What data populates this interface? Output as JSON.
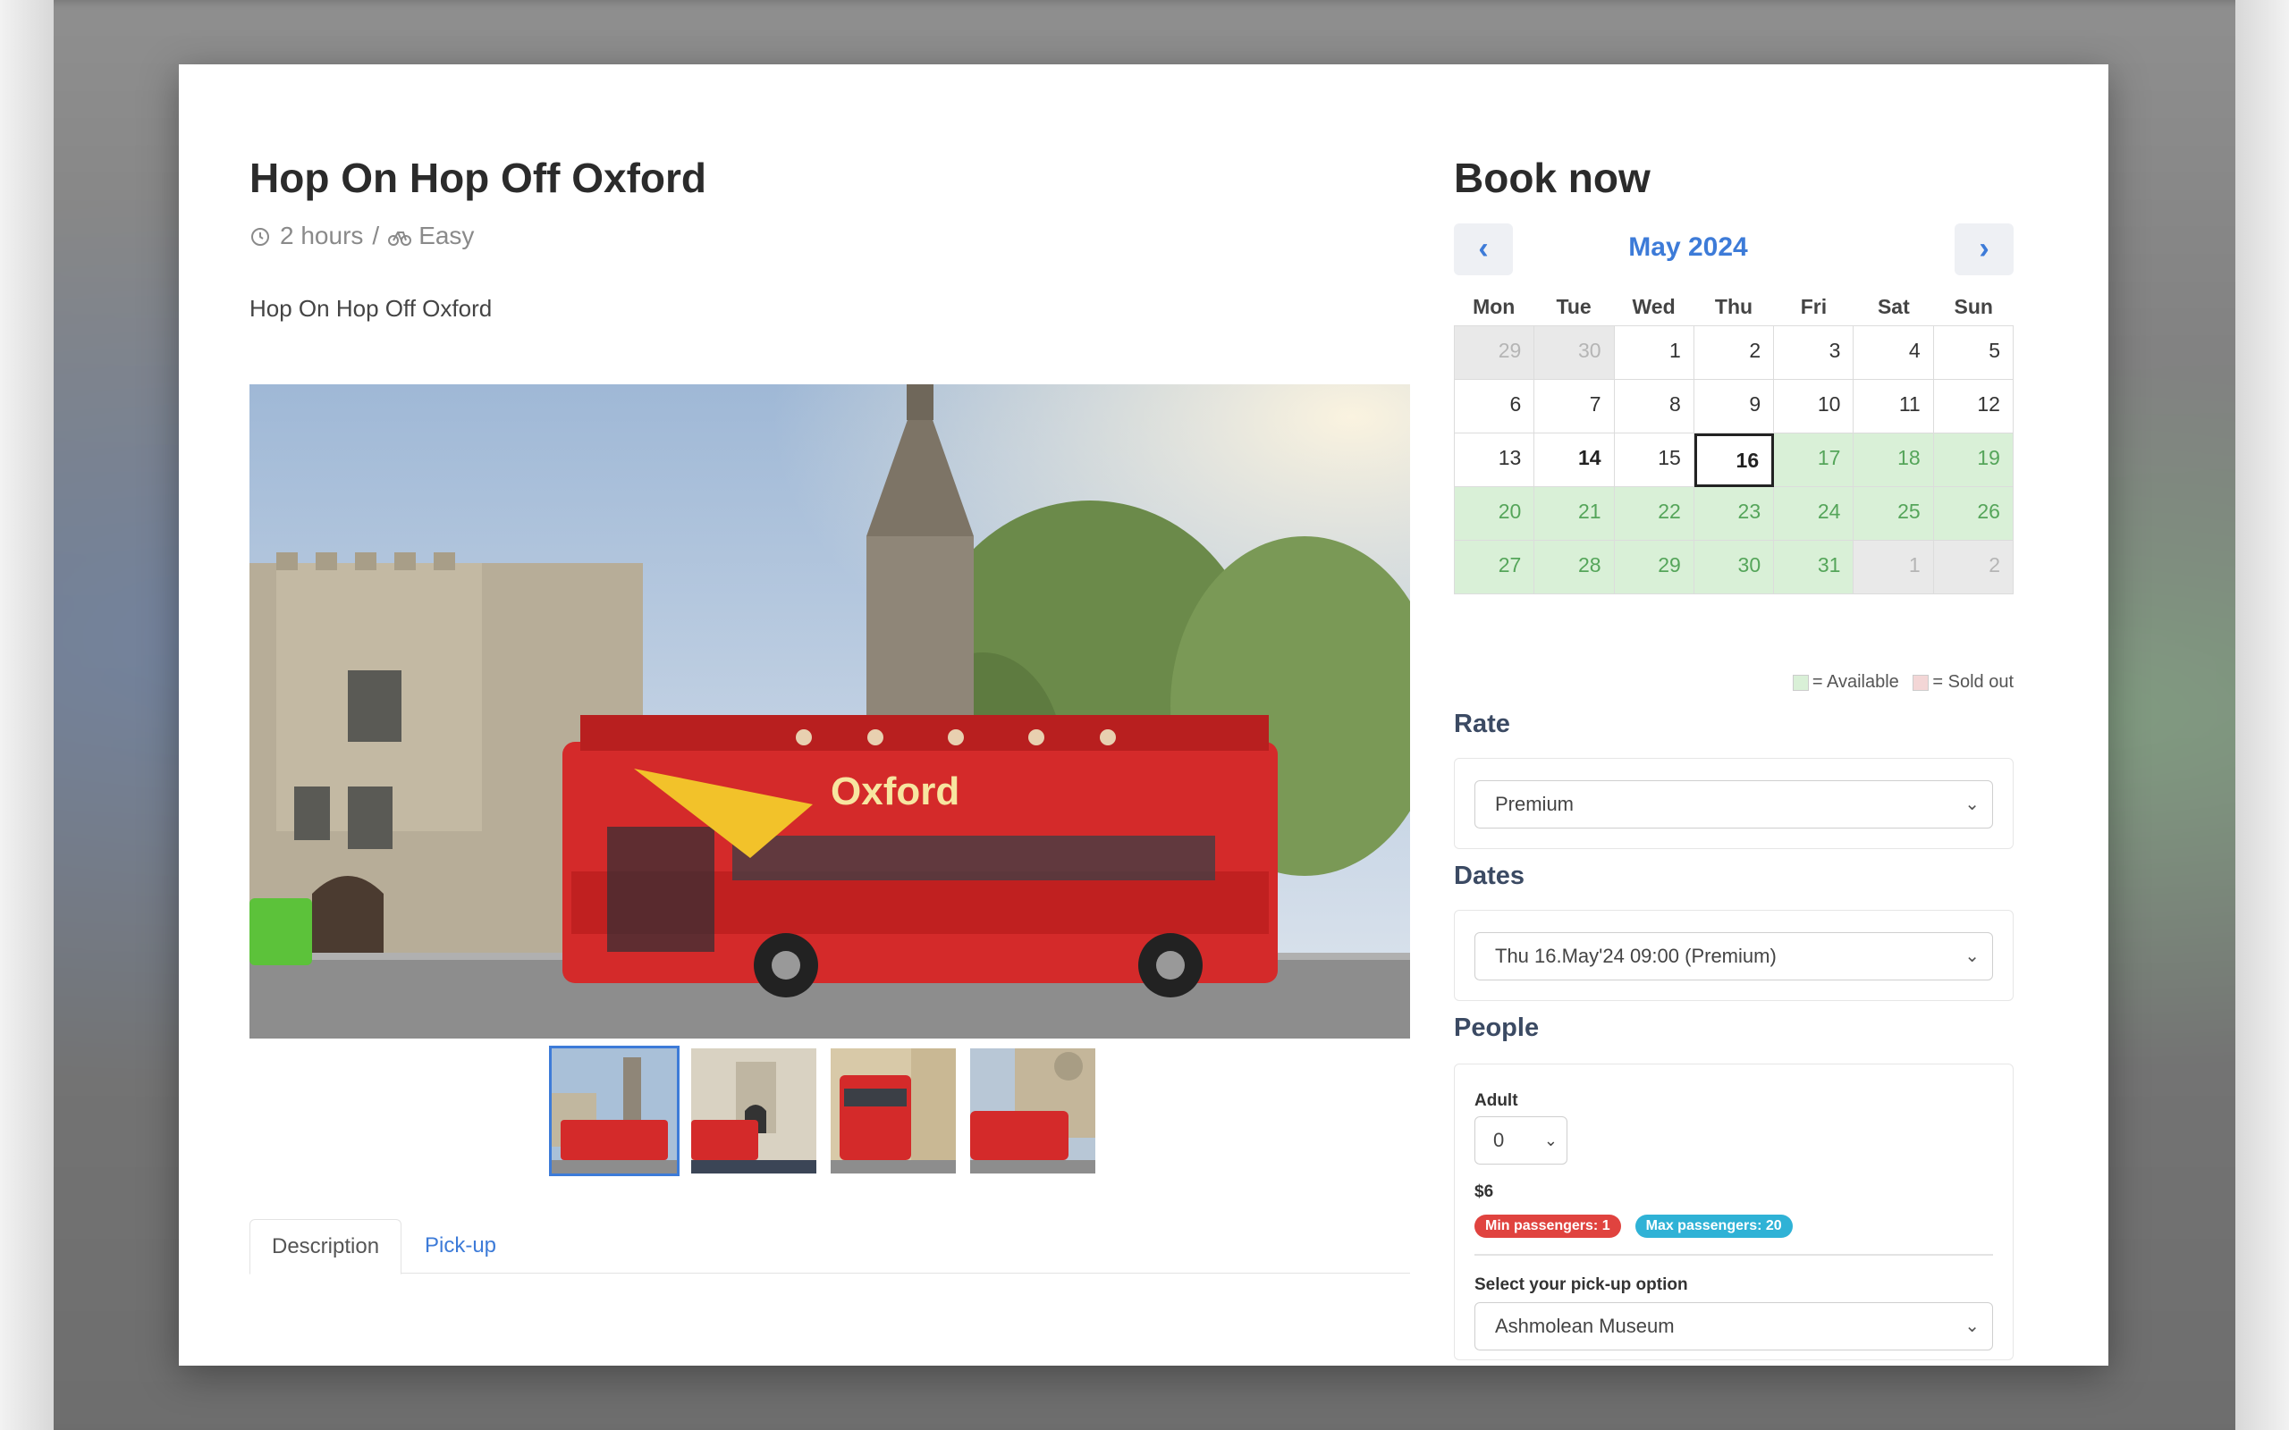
{
  "tour": {
    "title": "Hop On Hop Off Oxford",
    "duration": "2 hours",
    "separator": "/",
    "difficulty": "Easy",
    "short_description": "Hop On Hop Off Oxford"
  },
  "tabs": [
    {
      "label": "Description",
      "active": true
    },
    {
      "label": "Pick-up",
      "active": false
    }
  ],
  "booking": {
    "title": "Book now",
    "month": "May 2024",
    "prev_icon": "‹",
    "next_icon": "›",
    "weekdays": [
      "Mon",
      "Tue",
      "Wed",
      "Thu",
      "Fri",
      "Sat",
      "Sun"
    ],
    "days": [
      {
        "label": "29",
        "state": "muted"
      },
      {
        "label": "30",
        "state": "muted"
      },
      {
        "label": "1",
        "state": "normal"
      },
      {
        "label": "2",
        "state": "normal"
      },
      {
        "label": "3",
        "state": "normal"
      },
      {
        "label": "4",
        "state": "normal"
      },
      {
        "label": "5",
        "state": "normal"
      },
      {
        "label": "6",
        "state": "normal"
      },
      {
        "label": "7",
        "state": "normal"
      },
      {
        "label": "8",
        "state": "normal"
      },
      {
        "label": "9",
        "state": "normal"
      },
      {
        "label": "10",
        "state": "normal"
      },
      {
        "label": "11",
        "state": "normal"
      },
      {
        "label": "12",
        "state": "normal"
      },
      {
        "label": "13",
        "state": "normal"
      },
      {
        "label": "14",
        "state": "bold"
      },
      {
        "label": "15",
        "state": "normal"
      },
      {
        "label": "16",
        "state": "selected"
      },
      {
        "label": "17",
        "state": "avail"
      },
      {
        "label": "18",
        "state": "avail"
      },
      {
        "label": "19",
        "state": "avail"
      },
      {
        "label": "20",
        "state": "avail"
      },
      {
        "label": "21",
        "state": "avail"
      },
      {
        "label": "22",
        "state": "avail"
      },
      {
        "label": "23",
        "state": "avail"
      },
      {
        "label": "24",
        "state": "avail"
      },
      {
        "label": "25",
        "state": "avail"
      },
      {
        "label": "26",
        "state": "avail"
      },
      {
        "label": "27",
        "state": "avail"
      },
      {
        "label": "28",
        "state": "avail"
      },
      {
        "label": "29",
        "state": "avail"
      },
      {
        "label": "30",
        "state": "avail"
      },
      {
        "label": "31",
        "state": "avail"
      },
      {
        "label": "1",
        "state": "muted"
      },
      {
        "label": "2",
        "state": "muted"
      }
    ],
    "legend_available": "= Available",
    "legend_sold_out": "= Sold out",
    "rate_label": "Rate",
    "rate_value": "Premium",
    "dates_label": "Dates",
    "dates_value": "Thu 16.May'24 09:00 (Premium)",
    "people_label": "People",
    "adult_label": "Adult",
    "adult_qty": "0",
    "price": "$6",
    "min_passengers": "Min passengers: 1",
    "max_passengers": "Max passengers: 20",
    "pickup_label": "Select your pick-up option",
    "pickup_value": "Ashmolean Museum"
  },
  "colors": {
    "accent": "#3d7bd8",
    "available": "#d9f0d7",
    "sold_out": "#f3d6d6",
    "badge_red": "#e0433f",
    "badge_blue": "#2fb2d6"
  },
  "icons": {
    "duration": "clock-icon",
    "difficulty": "bike-icon",
    "select": "chevron-down-icon"
  }
}
